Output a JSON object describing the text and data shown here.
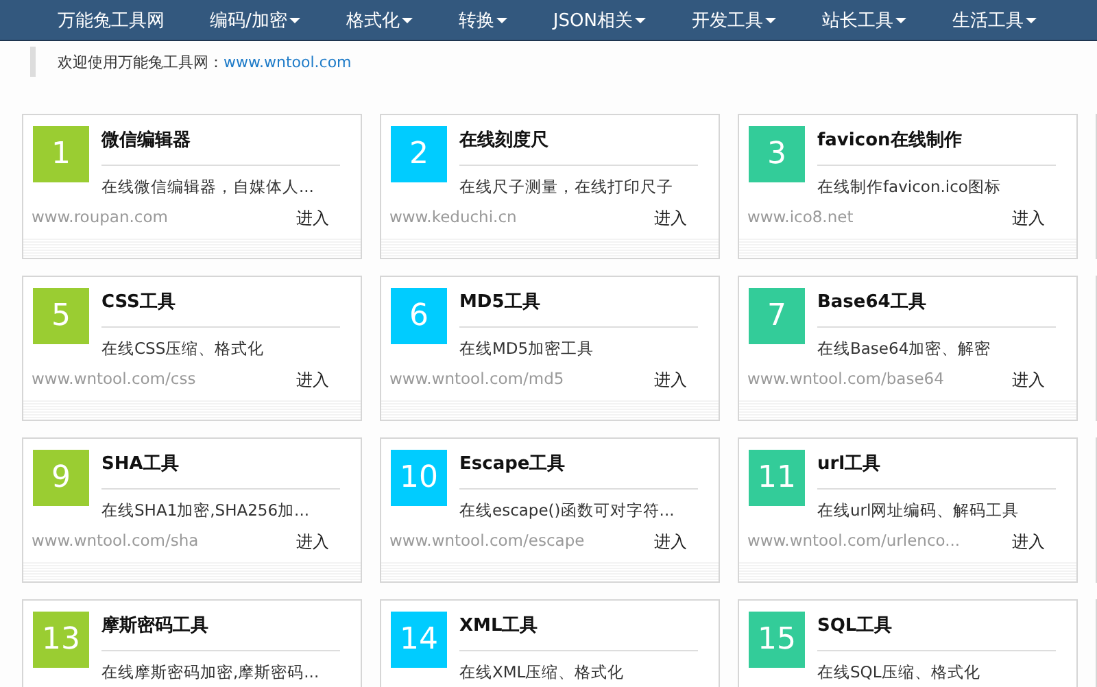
{
  "nav": {
    "items": [
      {
        "label": "万能兔工具网",
        "dropdown": false
      },
      {
        "label": "编码/加密",
        "dropdown": true
      },
      {
        "label": "格式化",
        "dropdown": true
      },
      {
        "label": "转换",
        "dropdown": true
      },
      {
        "label": "JSON相关",
        "dropdown": true
      },
      {
        "label": "开发工具",
        "dropdown": true
      },
      {
        "label": "站长工具",
        "dropdown": true
      },
      {
        "label": "生活工具",
        "dropdown": true
      }
    ]
  },
  "welcome": {
    "text": "欢迎使用万能兔工具网：",
    "link": "www.wntool.com"
  },
  "cards": [
    {
      "number": "1",
      "color": "#9acd32",
      "title": "微信编辑器",
      "description": "在线微信编辑器，自媒体人...",
      "url": "www.roupan.com",
      "action": "进入"
    },
    {
      "number": "2",
      "color": "#00ccff",
      "title": "在线刻度尺",
      "description": "在线尺子测量，在线打印尺子",
      "url": "www.keduchi.cn",
      "action": "进入"
    },
    {
      "number": "3",
      "color": "#33cc99",
      "title": "favicon在线制作",
      "description": "在线制作favicon.ico图标",
      "url": "www.ico8.net",
      "action": "进入"
    },
    {
      "number": "5",
      "color": "#9acd32",
      "title": "CSS工具",
      "description": "在线CSS压缩、格式化",
      "url": "www.wntool.com/css",
      "action": "进入"
    },
    {
      "number": "6",
      "color": "#00ccff",
      "title": "MD5工具",
      "description": "在线MD5加密工具",
      "url": "www.wntool.com/md5",
      "action": "进入"
    },
    {
      "number": "7",
      "color": "#33cc99",
      "title": "Base64工具",
      "description": "在线Base64加密、解密",
      "url": "www.wntool.com/base64",
      "action": "进入"
    },
    {
      "number": "9",
      "color": "#9acd32",
      "title": "SHA工具",
      "description": "在线SHA1加密,SHA256加...",
      "url": "www.wntool.com/sha",
      "action": "进入"
    },
    {
      "number": "10",
      "color": "#00ccff",
      "title": "Escape工具",
      "description": "在线escape()函数可对字符...",
      "url": "www.wntool.com/escape",
      "action": "进入"
    },
    {
      "number": "11",
      "color": "#33cc99",
      "title": "url工具",
      "description": "在线url网址编码、解码工具",
      "url": "www.wntool.com/urlenco...",
      "action": "进入"
    },
    {
      "number": "13",
      "color": "#9acd32",
      "title": "摩斯密码工具",
      "description": "在线摩斯密码加密,摩斯密码..."
    },
    {
      "number": "14",
      "color": "#00ccff",
      "title": "XML工具",
      "description": "在线XML压缩、格式化"
    },
    {
      "number": "15",
      "color": "#33cc99",
      "title": "SQL工具",
      "description": "在线SQL压缩、格式化"
    }
  ]
}
